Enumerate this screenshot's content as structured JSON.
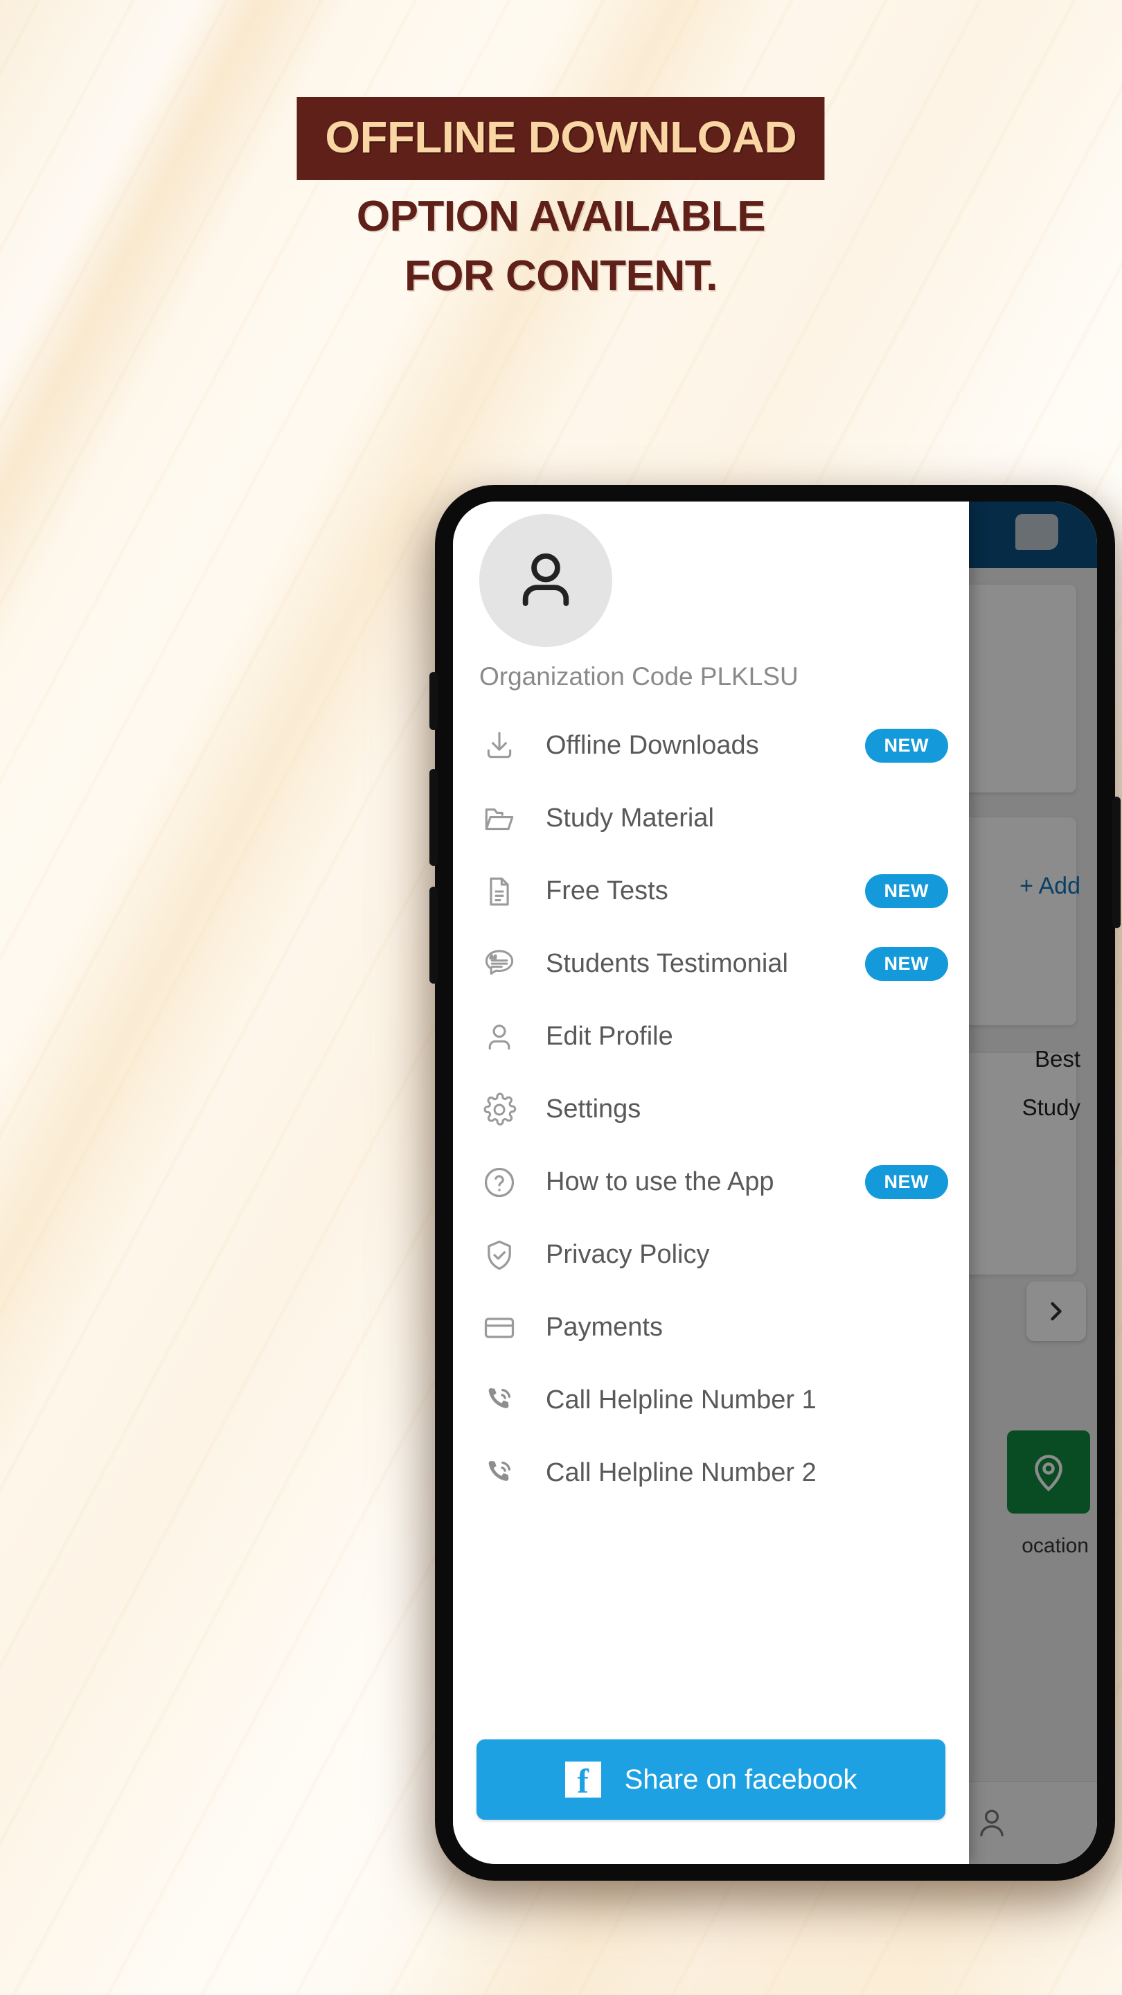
{
  "poster": {
    "headline_line1": "OFFLINE DOWNLOAD",
    "headline_line2": "OPTION AVAILABLE",
    "headline_line3": "FOR CONTENT.",
    "colors": {
      "headline_band_bg": "#5e2018",
      "headline_band_text": "#f9d6a4",
      "headline_text": "#5e2018",
      "page_bg": "#fdf3e3"
    }
  },
  "phone": {
    "app": {
      "drawer": {
        "avatar_icon": "person-icon",
        "org_code_label": "Organization Code PLKLSU",
        "menu_items": [
          {
            "icon": "download-icon",
            "label": "Offline Downloads",
            "badge": "NEW"
          },
          {
            "icon": "folder-icon",
            "label": "Study Material",
            "badge": ""
          },
          {
            "icon": "document-icon",
            "label": "Free Tests",
            "badge": "NEW"
          },
          {
            "icon": "testimonial-icon",
            "label": "Students Testimonial",
            "badge": "NEW"
          },
          {
            "icon": "person-icon",
            "label": "Edit Profile",
            "badge": ""
          },
          {
            "icon": "gear-icon",
            "label": "Settings",
            "badge": ""
          },
          {
            "icon": "question-icon",
            "label": "How to use the App",
            "badge": "NEW"
          },
          {
            "icon": "shield-check-icon",
            "label": "Privacy Policy",
            "badge": ""
          },
          {
            "icon": "card-icon",
            "label": "Payments",
            "badge": ""
          },
          {
            "icon": "phone-call-icon",
            "label": "Call Helpline Number 1",
            "badge": ""
          },
          {
            "icon": "phone-call-icon",
            "label": "Call Helpline Number 2",
            "badge": ""
          }
        ],
        "share_button": {
          "icon": "facebook-icon",
          "label": "Share on facebook",
          "color": "#1da1e2"
        },
        "badge_color": "#149ada"
      },
      "behind": {
        "add_link": "+ Add",
        "text_best": "Best",
        "text_study": "Study",
        "chevron_icon": "chevron-right-icon",
        "location_icon": "location-pin-icon",
        "location_label": "ocation",
        "nav_icon": "person-nav-icon",
        "topbar_color": "#0c4f80"
      }
    }
  }
}
